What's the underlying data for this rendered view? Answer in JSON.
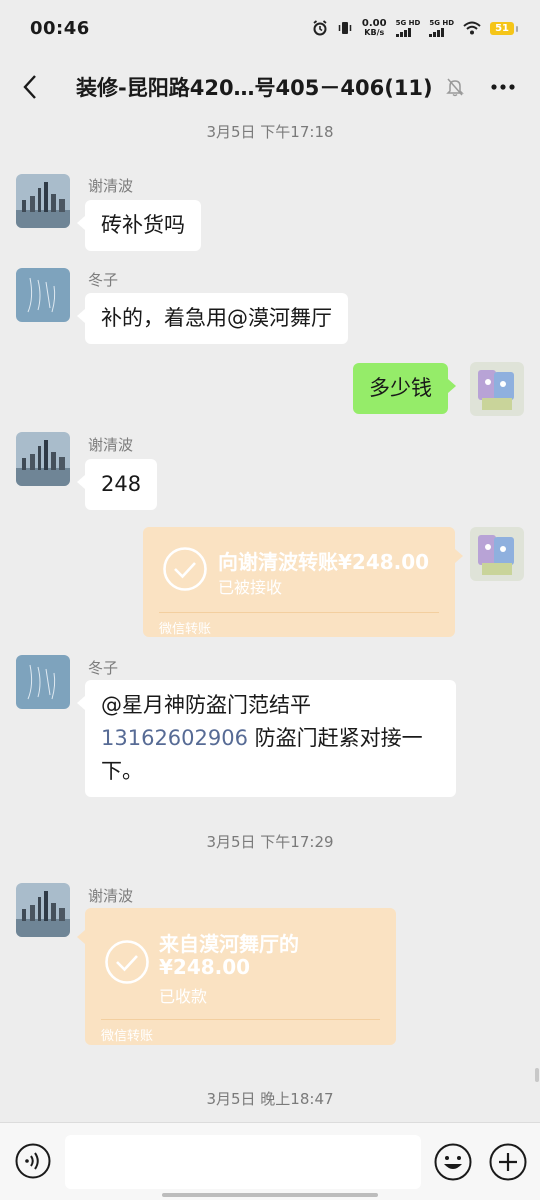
{
  "status": {
    "time": "00:46",
    "net_speed_value": "0.00",
    "net_speed_unit": "KB/s",
    "sim1": "5G HD",
    "sim2": "5G HD",
    "battery": "51"
  },
  "header": {
    "title": "装修-昆阳路420…号405－406(11)",
    "icons": [
      "back-icon",
      "mute-bell-icon",
      "more-icon"
    ]
  },
  "messages": {
    "ts1": "3月5日 下午17:18",
    "m1": {
      "sender": "谢清波",
      "text": "砖补货吗"
    },
    "m2": {
      "sender": "冬子",
      "text": "补的，着急用@漠河舞厅"
    },
    "m3": {
      "text": "多少钱"
    },
    "m4": {
      "sender": "谢清波",
      "text": "248"
    },
    "m5": {
      "title": "向谢清波转账¥248.00",
      "status": "已被接收",
      "footer": "微信转账"
    },
    "m6": {
      "sender": "冬子",
      "line1": "@星月神防盗门范结平",
      "phone": "13162602906",
      "line2_rest": " 防盗门赶紧对接一",
      "line3": "下。"
    },
    "ts2": "3月5日 下午17:29",
    "m7": {
      "sender": "谢清波",
      "title1": "来自漠河舞厅的",
      "amount": "¥248.00",
      "status": "已收款",
      "footer": "微信转账"
    },
    "ts3": "3月5日 晚上18:47"
  },
  "input_bar": {
    "placeholder": "",
    "icons": [
      "voice-icon",
      "emoji-icon",
      "plus-icon"
    ]
  },
  "colors": {
    "background": "#ededed",
    "my_bubble": "#95ec69",
    "transfer_card": "#fae2c2",
    "link": "#576b95"
  }
}
